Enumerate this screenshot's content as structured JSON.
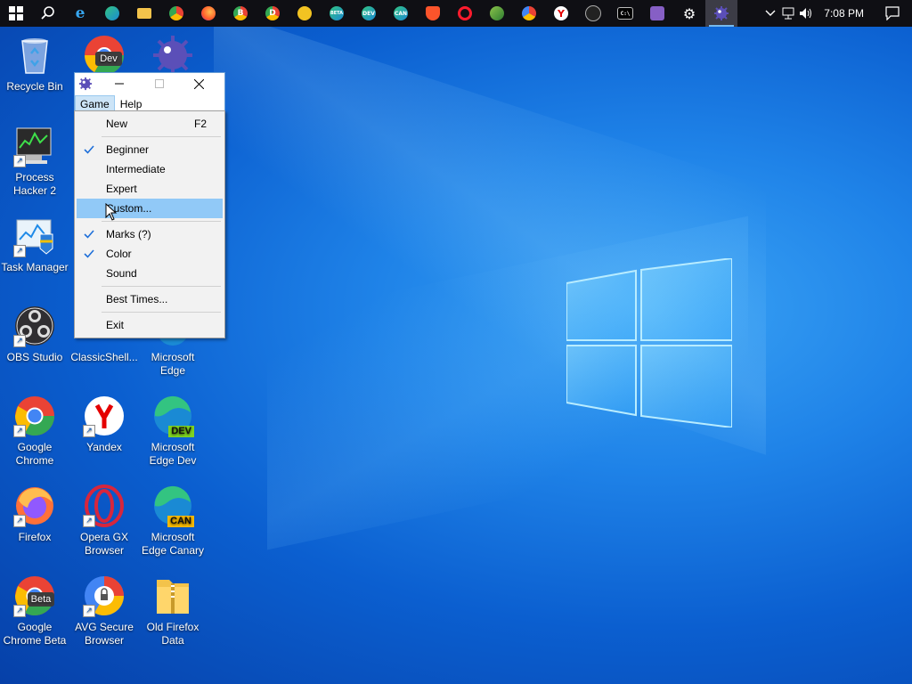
{
  "taskbar": {
    "icons": [
      "start-icon",
      "search-icon",
      "internet-explorer-icon",
      "edge-icon",
      "file-explorer-icon",
      "chrome-icon",
      "firefox-icon",
      "chrome-beta-icon",
      "chrome-dev-icon",
      "chrome-canary-icon",
      "edge-beta-icon",
      "edge-dev-icon",
      "edge-canary-icon",
      "brave-icon",
      "opera-icon",
      "opera-gx-icon",
      "avg-browser-icon",
      "yandex-icon",
      "obs-icon",
      "cmd-icon",
      "visual-studio-icon",
      "settings-icon",
      "minesweeper-icon"
    ],
    "edge_beta_badge": "BETA",
    "edge_dev_badge": "DEV",
    "edge_canary_badge": "CAN",
    "chrome_beta_badge": "B",
    "chrome_dev_badge": "D",
    "cmd_label": "C:\\",
    "time": "7:08 PM"
  },
  "desktop": {
    "icons": [
      {
        "label": "Recycle Bin"
      },
      {
        "label": "Dev"
      },
      {
        "label": "Process Hacker 2"
      },
      {
        "label": "Task Manager"
      },
      {
        "label": "OBS Studio"
      },
      {
        "label": "ClassicShell..."
      },
      {
        "label": "Microsoft Edge"
      },
      {
        "label": "Google Chrome"
      },
      {
        "label": "Yandex"
      },
      {
        "label": "Microsoft Edge Dev",
        "badge": "DEV"
      },
      {
        "label": "Firefox"
      },
      {
        "label": "Opera GX Browser"
      },
      {
        "label": "Microsoft Edge Canary",
        "badge": "CAN"
      },
      {
        "label": "Google Chrome Beta",
        "badge": "Beta"
      },
      {
        "label": "AVG Secure Browser"
      },
      {
        "label": "Old Firefox Data"
      }
    ]
  },
  "window": {
    "menus": [
      "Game",
      "Help"
    ]
  },
  "game_menu": {
    "new": {
      "label": "New",
      "accel": "F2"
    },
    "beginner": {
      "label": "Beginner",
      "checked": true
    },
    "intermediate": {
      "label": "Intermediate",
      "checked": false
    },
    "expert": {
      "label": "Expert",
      "checked": false
    },
    "custom": {
      "label": "Custom...",
      "highlighted": true
    },
    "marks": {
      "label": "Marks (?)",
      "checked": true
    },
    "color": {
      "label": "Color",
      "checked": true
    },
    "sound": {
      "label": "Sound",
      "checked": false
    },
    "best_times": {
      "label": "Best Times..."
    },
    "exit": {
      "label": "Exit"
    }
  }
}
